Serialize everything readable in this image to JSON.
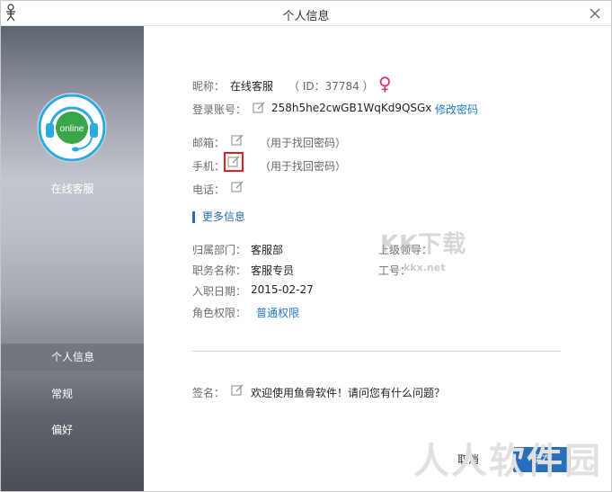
{
  "window": {
    "title": "个人信息"
  },
  "sidebar": {
    "avatar_text": "online",
    "username": "在线客服",
    "items": [
      {
        "label": "个人信息",
        "active": true
      },
      {
        "label": "常规",
        "active": false
      },
      {
        "label": "偏好",
        "active": false
      }
    ]
  },
  "profile": {
    "nickname_label": "昵称：",
    "nickname_value": "在线客服",
    "id_text": "（ ID：37784 ）",
    "gender_symbol": "♀",
    "gender_color": "#e0297a",
    "login_label": "登录账号：",
    "login_value": "258h5he2cwGB1WqKd9QSGx",
    "change_password": "修改密码",
    "email_label": "邮箱：",
    "email_hint": "（用于找回密码）",
    "phone_label": "手机：",
    "phone_hint": "（用于找回密码）",
    "tel_label": "电话："
  },
  "more": {
    "title": "更多信息",
    "dept_label": "归属部门：",
    "dept_value": "客服部",
    "leader_label": "上级领导：",
    "title_label": "职务名称：",
    "title_value": "客服专员",
    "employee_no_label": "工号：",
    "join_label": "入职日期：",
    "join_value": "2015-02-27",
    "role_label": "角色权限：",
    "role_value": "普通权限"
  },
  "signature": {
    "label": "签名：",
    "value": "欢迎使用鱼骨软件！请问您有什么问题？"
  },
  "watermarks": {
    "main": "KK下载",
    "sub": "kkx.net",
    "bottom": "人人软件园"
  },
  "buttons": {
    "cancel": "取消",
    "save": "保存"
  },
  "colors": {
    "accent": "#1f78c7",
    "highlight": "#e02020",
    "avatar_ring": "#2ea8e0",
    "avatar_fill": "#3aa64c"
  }
}
